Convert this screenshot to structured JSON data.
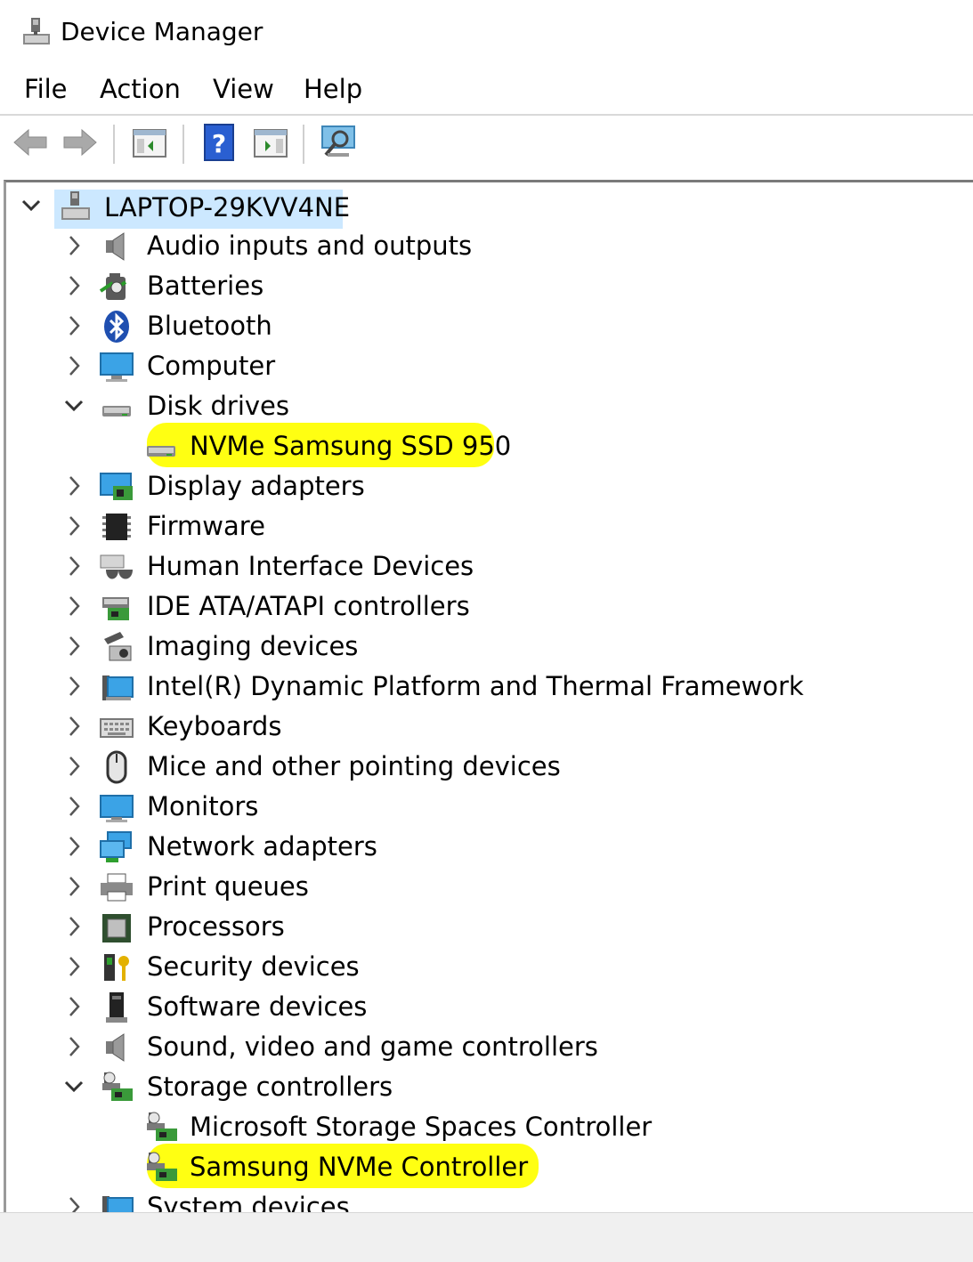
{
  "window": {
    "title": "Device Manager"
  },
  "menu": [
    "File",
    "Action",
    "View",
    "Help"
  ],
  "toolbar": {
    "buttons": [
      "back-icon",
      "forward-icon",
      "show-hide-console-tree-icon",
      "help-icon",
      "properties-pane-icon",
      "scan-hardware-icon"
    ]
  },
  "tree": {
    "root": "LAPTOP-29KVV4NE",
    "categories": [
      {
        "label": "Audio inputs and outputs",
        "icon": "speaker-icon",
        "expanded": false
      },
      {
        "label": "Batteries",
        "icon": "battery-icon",
        "expanded": false
      },
      {
        "label": "Bluetooth",
        "icon": "bluetooth-icon",
        "expanded": false
      },
      {
        "label": "Computer",
        "icon": "computer-icon",
        "expanded": false
      },
      {
        "label": "Disk drives",
        "icon": "disk-drive-icon",
        "expanded": true
      },
      {
        "label": "NVMe Samsung SSD 950",
        "icon": "disk-drive-icon",
        "child": true,
        "highlighted": true
      },
      {
        "label": "Display adapters",
        "icon": "display-adapter-icon",
        "expanded": false
      },
      {
        "label": "Firmware",
        "icon": "firmware-chip-icon",
        "expanded": false
      },
      {
        "label": "Human Interface Devices",
        "icon": "hid-icon",
        "expanded": false
      },
      {
        "label": "IDE ATA/ATAPI controllers",
        "icon": "ide-controller-icon",
        "expanded": false
      },
      {
        "label": "Imaging devices",
        "icon": "camera-icon",
        "expanded": false
      },
      {
        "label": "Intel(R) Dynamic Platform and Thermal Framework",
        "icon": "thermal-icon",
        "expanded": false
      },
      {
        "label": "Keyboards",
        "icon": "keyboard-icon",
        "expanded": false
      },
      {
        "label": "Mice and other pointing devices",
        "icon": "mouse-icon",
        "expanded": false
      },
      {
        "label": "Monitors",
        "icon": "monitor-icon",
        "expanded": false
      },
      {
        "label": "Network adapters",
        "icon": "network-icon",
        "expanded": false
      },
      {
        "label": "Print queues",
        "icon": "printer-icon",
        "expanded": false
      },
      {
        "label": "Processors",
        "icon": "processor-icon",
        "expanded": false
      },
      {
        "label": "Security devices",
        "icon": "security-key-icon",
        "expanded": false
      },
      {
        "label": "Software devices",
        "icon": "software-device-icon",
        "expanded": false
      },
      {
        "label": "Sound, video and game controllers",
        "icon": "speaker-icon",
        "expanded": false
      },
      {
        "label": "Storage controllers",
        "icon": "storage-controller-icon",
        "expanded": true
      },
      {
        "label": "Microsoft Storage Spaces Controller",
        "icon": "storage-controller-icon",
        "child": true
      },
      {
        "label": "Samsung NVMe Controller",
        "icon": "storage-controller-icon",
        "child": true,
        "highlighted": true
      },
      {
        "label": "System devices",
        "icon": "system-devices-icon",
        "expanded": false
      }
    ]
  },
  "colors": {
    "highlight": "#ffff00",
    "selection": "#cce8ff",
    "statusbar": "#f0f0f0"
  }
}
